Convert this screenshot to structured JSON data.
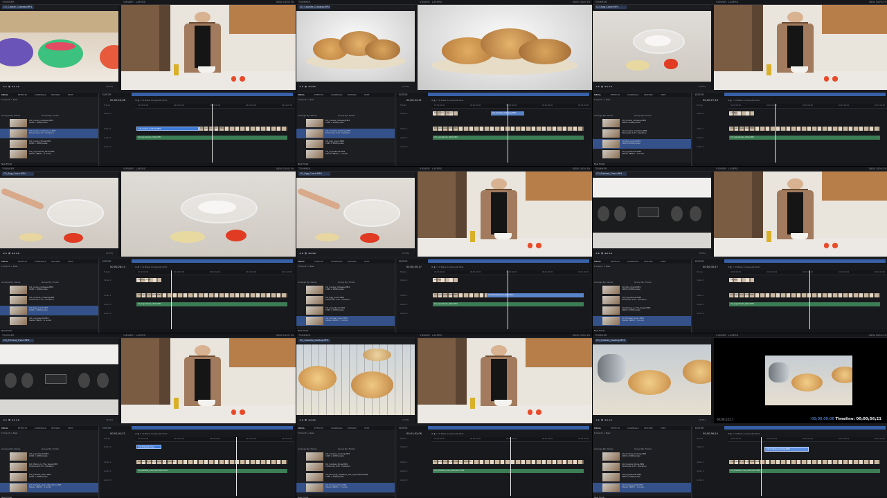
{
  "app": {
    "trimmer_title": "TRIMMER",
    "viewer_title": "VIEWER",
    "viewer_mode": "LAYERS",
    "view_menu": "VIEW",
    "zoom_menu": "100%",
    "fit_label": "Fit",
    "zoom_level": "(3:4%)",
    "editor_title": "EDITOR",
    "composite_label": "Make Composite Shot",
    "media_tabs": [
      "MEDIA",
      "EFFECTS",
      "CONTROLS",
      "HISTORY",
      "TEXT"
    ],
    "media_import": "Import",
    "media_new": "New",
    "arrange_by": "Arrange By: Name",
    "group_by": "Group By: Folder",
    "media_footer": "New Folder",
    "tracks": [
      "Tracks",
      "Video 2",
      "Video 1",
      "Audio 1",
      "Audio 2"
    ],
    "ruler_times": [
      "00:00:00;00",
      "00:00:20;00",
      "00:00:40;00",
      "00:01:00;00",
      "00:01:20;00"
    ]
  },
  "panels": [
    {
      "trim_tab": "CO_Cookie_Cutaway.MP4",
      "trim_shot": "bowls",
      "view_shot": "host",
      "timecode": "00;00;23;08",
      "media_items": [
        {
          "name": "CO_Cookie_Cutaway.MP4",
          "meta": "1920 x 1080 pixels",
          "sel": false
        },
        {
          "name": "CO_Cookie_Cutaway_2.MP4",
          "meta": "Timecode 1:23 ; Duration",
          "sel": true
        },
        {
          "name": "CO_Cookie_Shoot.MP4",
          "meta": "1920 x 1080 pixels",
          "sel": false
        },
        {
          "name": "CO_Ingredients_Wide.MP4",
          "meta": "Stereo 48kHz ; 1 Audio",
          "sel": false
        }
      ],
      "clips": [
        {
          "track": 2,
          "kind": "sel",
          "label": "CO_Cookie_Cutaway.MP4"
        },
        {
          "track": 2,
          "kind": "video",
          "label": "CO_Ingredients_Wide.MP4"
        },
        {
          "track": 3,
          "kind": "audio",
          "label": "CO_Ingredients_Wide.MP4"
        }
      ]
    },
    {
      "trim_tab": "CO_Cookies_Cutaway.MP4",
      "trim_shot": "cookies",
      "view_shot": "cookies",
      "timecode": "00;00;31;21",
      "media_items": [
        {
          "name": "CO_Cookie_Cutaway.MP4",
          "meta": "1920 x 1080 pixels",
          "sel": false
        },
        {
          "name": "CO_Cookies_Cutaway.MP4",
          "meta": "Timecode 1:23 ; Duration",
          "sel": true
        },
        {
          "name": "CO_Egg_Crack.MP4",
          "meta": "1920 x 1080 pixels",
          "sel": false
        },
        {
          "name": "CO_Ingredients.MP4",
          "meta": "Stereo 48kHz ; 1 Audio",
          "sel": false
        }
      ],
      "clips": [
        {
          "track": 1,
          "kind": "vid2",
          "label": "CO_Cookie_Cutaway"
        },
        {
          "track": 1,
          "kind": "videob",
          "label": "CO_Cookies_Cutaway.MP4"
        },
        {
          "track": 2,
          "kind": "video",
          "label": "CO_Ingredients_Wide.MP4"
        },
        {
          "track": 3,
          "kind": "audio",
          "label": "CO_Ingredients_Wide.MP4"
        }
      ]
    },
    {
      "trim_tab": "CO_Egg_Crack.MP4",
      "trim_shot": "bowl-table",
      "view_shot": "host",
      "timecode": "00;00;27;18",
      "media_items": [
        {
          "name": "CO_Cookie_Cutaway.MP4",
          "meta": "1920 x 1080 pixels",
          "sel": false
        },
        {
          "name": "CO_Cookies_Cutaway.MP4",
          "meta": "Timecode 1:23 ; Duration",
          "sel": false
        },
        {
          "name": "CO_Egg_Crack.MP4",
          "meta": "1920 x 1080 pixels",
          "sel": true
        },
        {
          "name": "CO_Ingredients.MP4",
          "meta": "Stereo 48kHz ; 1 Audio",
          "sel": false
        }
      ],
      "clips": [
        {
          "track": 1,
          "kind": "vid2",
          "label": "CO_Egg"
        },
        {
          "track": 2,
          "kind": "video",
          "label": "CO_Ingredients_Wide.MP4"
        },
        {
          "track": 3,
          "kind": "audio",
          "label": "CO_Ingredients_Wide.MP4"
        }
      ]
    },
    {
      "trim_tab": "CO_Egg_Crack.MP4",
      "trim_shot": "hand-bowl",
      "view_shot": "bowl-table",
      "timecode": "00;00;26;14",
      "media_items": [
        {
          "name": "CO_Cookie_Cutaway.MP4",
          "meta": "1920 x 1080 pixels",
          "sel": false
        },
        {
          "name": "CO_Cookies_Cutaway.MP4",
          "meta": "Timecode 1:23 ; Duration",
          "sel": false
        },
        {
          "name": "CO_Egg_Crack.MP4",
          "meta": "1920 x 1080 pixels",
          "sel": true
        },
        {
          "name": "CO_Ingredients.MP4",
          "meta": "Stereo 48kHz ; 1 Audio",
          "sel": false
        }
      ],
      "clips": [
        {
          "track": 1,
          "kind": "vid2",
          "label": "CO_Egg_Crack"
        },
        {
          "track": 2,
          "kind": "video",
          "label": "CO_Ingredients_Wide.MP4"
        },
        {
          "track": 3,
          "kind": "audio",
          "label": "CO_Ingredients_Wide.MP4"
        }
      ]
    },
    {
      "trim_tab": "CO_Egg_Crack.MP4",
      "trim_shot": "hand-bowl",
      "view_shot": "host",
      "timecode": "00;00;35;17",
      "media_items": [
        {
          "name": "CO_Cookie_Cutaway.MP4",
          "meta": "1920 x 1080 pixels",
          "sel": false
        },
        {
          "name": "CO_Egg_Crack.MP4",
          "meta": "Timecode 1:23 ; Duration",
          "sel": false
        },
        {
          "name": "CO_Ingredients.MP4",
          "meta": "1920 x 1080 pixels",
          "sel": false
        },
        {
          "name": "CO_Preheat_Oven.MP4",
          "meta": "Stereo 48kHz ; 1 Audio",
          "sel": true
        }
      ],
      "clips": [
        {
          "track": 1,
          "kind": "vid2",
          "label": "CO_Egg"
        },
        {
          "track": 2,
          "kind": "video",
          "label": "CO_Ingredients_Wide.MP4"
        },
        {
          "track": 2,
          "kind": "videob",
          "label": "CO_Preheat_Oven_Narration"
        },
        {
          "track": 3,
          "kind": "audio",
          "label": "CO_Ingredients_Wide.MP4"
        }
      ]
    },
    {
      "trim_tab": "CO_Preheat_Oven.MP4",
      "trim_shot": "oven",
      "view_shot": "host",
      "timecode": "00;00;35;17",
      "media_items": [
        {
          "name": "CO_Egg_Crack.MP4",
          "meta": "1920 x 1080 pixels",
          "sel": false
        },
        {
          "name": "CO_Ingredients.MP4",
          "meta": "Timecode 1:23 ; Duration",
          "sel": false
        },
        {
          "name": "CO_Mixing_In_The_Sugar.MP4",
          "meta": "1920 x 1080 pixels",
          "sel": false
        },
        {
          "name": "CO_Preheat_Oven.MP4",
          "meta": "Stereo 48kHz ; 1 Audio",
          "sel": true
        }
      ],
      "clips": [
        {
          "track": 1,
          "kind": "vid2",
          "label": "CO_Egg"
        },
        {
          "track": 2,
          "kind": "video",
          "label": "CO_Ingredients_Wide.MP4"
        },
        {
          "track": 3,
          "kind": "audio",
          "label": "CO_Ingredients_Wide.MP4"
        }
      ]
    },
    {
      "trim_tab": "CO_Preheat_Oven.MP4",
      "trim_shot": "oven",
      "view_shot": "host",
      "timecode": "00;01;01;22",
      "media_items": [
        {
          "name": "CO_Ingredients.MP4",
          "meta": "1920 x 1080 pixels",
          "sel": false
        },
        {
          "name": "CO_Mixing_In_The_Sugar.MP4",
          "meta": "Timecode 1:23 ; Duration",
          "sel": false
        },
        {
          "name": "CO_Preheat_Oven.MP4",
          "meta": "1920 x 1080 pixels",
          "sel": false
        },
        {
          "name": "CO_Preheat_Oven_Narration.MP4",
          "meta": "Stereo 48kHz ; 1 Audio",
          "sel": true
        }
      ],
      "clips": [
        {
          "track": 1,
          "kind": "sel",
          "label": "CO_Preheat_Oven"
        },
        {
          "track": 2,
          "kind": "video",
          "label": "CO_Preheat_Oven_Narration_1_Wide.MP4"
        },
        {
          "track": 3,
          "kind": "audio",
          "label": "CO_Preheat_Oven_Narration.MP4"
        }
      ]
    },
    {
      "trim_tab": "CO_Cookies_Cooling.MP4",
      "trim_shot": "rack",
      "view_shot": "host",
      "timecode": "00;01;01;06",
      "media_items": [
        {
          "name": "CO_Cookies_Cooling.MP4",
          "meta": "1920 x 1080 pixels",
          "sel": false
        },
        {
          "name": "CO_Cookies_Done.MP4",
          "meta": "Timecode 1:23 ; Duration",
          "sel": false
        },
        {
          "name": "CO_Bringing_Together_The_Ingredients.MP4",
          "meta": "1920 x 1080 pixels",
          "sel": false
        },
        {
          "name": "CO_Closing_Shot.MP4",
          "meta": "Stereo 48kHz ; 1 Audio",
          "sel": true
        }
      ],
      "clips": [
        {
          "track": 2,
          "kind": "video",
          "label": "CO_Preheat_Oven_Narration_1_Wide.MP4"
        },
        {
          "track": 3,
          "kind": "audio",
          "label": "CO_Preheat_Oven_Narration.MP4"
        }
      ]
    },
    {
      "trim_tab": "CO_Cookies_Cooling.MP4",
      "trim_shot": "rack-kettle",
      "view_shot": "preview",
      "timecode": "00;00;56;14",
      "viewer_left_tc": "00;00;14;17",
      "viewer_delta": "-00;00;00;06",
      "viewer_timeline": "Timeline: 00;00;56;21",
      "drag_label": "CO_Cookies_Cooling.MP4",
      "media_items": [
        {
          "name": "CO_Cookies_Cooling.MP4",
          "meta": "1920 x 1080 pixels",
          "sel": false
        },
        {
          "name": "CO_Cookies_Done.MP4",
          "meta": "Timecode 1:23 ; Duration",
          "sel": false
        },
        {
          "name": "CO_Ingredients.MP4",
          "meta": "1920 x 1080 pixels",
          "sel": false
        },
        {
          "name": "CO_Closing_Shot.MP4",
          "meta": "Stereo 48kHz ; 1 Audio",
          "sel": true
        }
      ],
      "clips": [
        {
          "track": 2,
          "kind": "video",
          "label": "CO_Preheat_Oven_Narration.MP4"
        },
        {
          "track": 3,
          "kind": "audio",
          "label": "CO_Preheat_Oven_Narration.MP4"
        }
      ]
    }
  ],
  "colors": {
    "selection": "#34518a",
    "clip_blue": "#3f7ad6",
    "clip_audio": "#3c7d55",
    "accent_blue": "#3e6fc2"
  }
}
